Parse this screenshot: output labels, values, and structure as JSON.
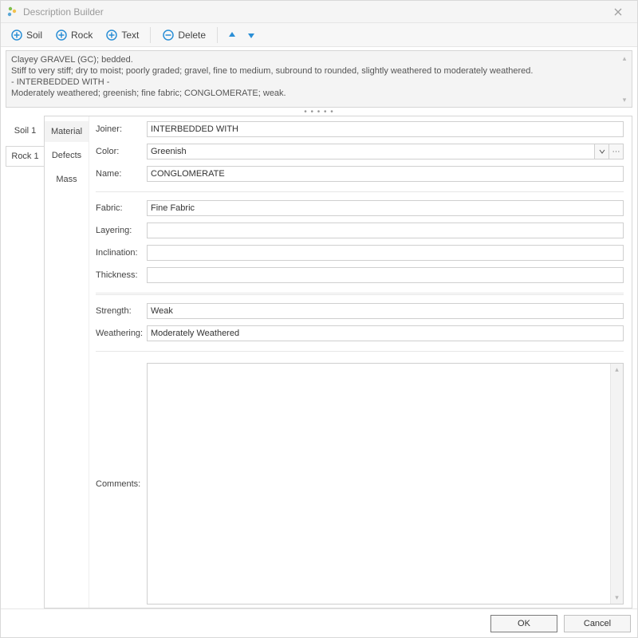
{
  "window": {
    "title": "Description Builder"
  },
  "toolbar": {
    "soil": "Soil",
    "rock": "Rock",
    "text": "Text",
    "delete": "Delete"
  },
  "preview": {
    "line1": "Clayey GRAVEL (GC); bedded.",
    "line2": "Stiff to very stiff; dry to moist; poorly graded; gravel, fine to medium, subround to rounded, slightly weathered to moderately weathered.",
    "line3": " - INTERBEDDED WITH -",
    "line4": "Moderately weathered; greenish; fine fabric;  CONGLOMERATE; weak."
  },
  "left_tabs": {
    "soil": "Soil 1",
    "rock": "Rock 1"
  },
  "inner_tabs": {
    "material": "Material",
    "defects": "Defects",
    "mass": "Mass"
  },
  "labels": {
    "joiner": "Joiner:",
    "color": "Color:",
    "name": "Name:",
    "fabric": "Fabric:",
    "layering": "Layering:",
    "inclination": "Inclination:",
    "thickness": "Thickness:",
    "strength": "Strength:",
    "weathering": "Weathering:",
    "comments": "Comments:"
  },
  "values": {
    "joiner": "INTERBEDDED WITH",
    "color": "Greenish",
    "name": "CONGLOMERATE",
    "fabric": "Fine Fabric",
    "layering": "",
    "inclination": "",
    "thickness": "",
    "strength": "Weak",
    "weathering": "Moderately Weathered",
    "comments": ""
  },
  "footer": {
    "ok": "OK",
    "cancel": "Cancel"
  },
  "splitter_dots": "• • • • •"
}
